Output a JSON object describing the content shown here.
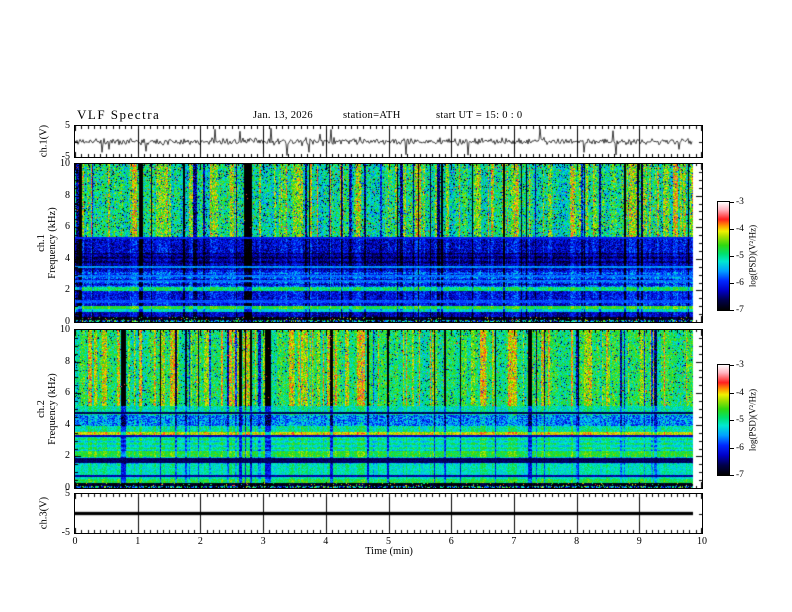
{
  "title": "VLF  Spectra",
  "header": {
    "date": "Jan. 13, 2026",
    "station": "station=ATH",
    "start_ut": "start UT =  15: 0  : 0"
  },
  "time_axis": {
    "label": "Time  (min)",
    "range": [
      0,
      10
    ],
    "ticks": [
      0,
      1,
      2,
      3,
      4,
      5,
      6,
      7,
      8,
      9,
      10
    ],
    "minor_step_min": 0.1,
    "data_end_min": 9.85
  },
  "colorbar": {
    "label": "log(PSD)(V²/Hz)",
    "ticks": [
      -3,
      -4,
      -5,
      -6,
      -7
    ],
    "range": [
      -7,
      -3
    ],
    "stops": [
      [
        0.0,
        "#000000"
      ],
      [
        0.09,
        "#00004a"
      ],
      [
        0.18,
        "#0000c8"
      ],
      [
        0.27,
        "#0028ff"
      ],
      [
        0.36,
        "#00a0ff"
      ],
      [
        0.45,
        "#00e8d0"
      ],
      [
        0.52,
        "#00e070"
      ],
      [
        0.6,
        "#30d810"
      ],
      [
        0.68,
        "#a8e000"
      ],
      [
        0.73,
        "#f0f000"
      ],
      [
        0.78,
        "#ff9800"
      ],
      [
        0.84,
        "#ff2020"
      ],
      [
        0.93,
        "#ffb4c0"
      ],
      [
        1.0,
        "#ffffff"
      ]
    ]
  },
  "colors": {
    "background": "#ffffff",
    "frame": "#000000",
    "trace": "#000000"
  },
  "chart_data": [
    {
      "type": "line",
      "id": "ch1_wave",
      "ylabel": "ch.1(V)",
      "ylim": [
        -5,
        5
      ],
      "yticks": [
        5,
        -5
      ],
      "description": "broadband noise about 0 V, ~±1 V band with impulsive spikes to ±5 V, data 0–9.85 min",
      "signal": {
        "mean": 0,
        "noise_sigma": 0.5,
        "spike_prob": 0.022,
        "spike_amp": [
          2.2,
          4.8
        ]
      },
      "seed": 11
    },
    {
      "type": "heatmap",
      "id": "ch1_spec",
      "ylabel_lines": [
        "ch.1",
        "Frequency  (kHz)"
      ],
      "ylim": [
        0,
        10
      ],
      "yticks": [
        10,
        8,
        6,
        4,
        2,
        0
      ],
      "value_range": [
        -7,
        -3
      ],
      "streak_min_f": 5.25,
      "seed": 42,
      "bands": [
        {
          "f": [
            5.25,
            10.0
          ],
          "v": -5.0,
          "jitter": 0.6,
          "dark_speckle": 0.08,
          "red_speckle": 0.01
        },
        {
          "f": [
            4.35,
            5.25
          ],
          "v": -6.25,
          "jitter": 0.45
        },
        {
          "f": [
            3.3,
            4.35
          ],
          "v": -6.5,
          "jitter": 0.35,
          "stripe": 0.2
        },
        {
          "f": [
            2.2,
            3.3
          ],
          "v": -6.0,
          "jitter": 0.45,
          "stripe": 0.25
        },
        {
          "f": [
            1.95,
            2.2
          ],
          "v": -4.95,
          "jitter": 0.3
        },
        {
          "f": [
            1.0,
            1.95
          ],
          "v": -6.15,
          "jitter": 0.4
        },
        {
          "f": [
            0.82,
            1.0
          ],
          "v": -4.7,
          "jitter": 0.25
        },
        {
          "f": [
            0.62,
            0.82
          ],
          "v": -5.3,
          "jitter": 0.3
        },
        {
          "f": [
            0.3,
            0.62
          ],
          "v": -6.35,
          "jitter": 0.35
        },
        {
          "f": [
            0.12,
            0.3
          ],
          "v": -6.95,
          "jitter": 0.1,
          "speckle": 0.06
        },
        {
          "f": [
            0.0,
            0.12
          ],
          "v": -5.8,
          "jitter": 1.5
        }
      ],
      "h_lines": [
        {
          "f": 5.3,
          "v": -6.0
        },
        {
          "f": 3.5,
          "v": -5.6
        },
        {
          "f": 2.9,
          "v": -5.7
        },
        {
          "f": 2.6,
          "v": -5.7
        },
        {
          "f": 1.3,
          "v": -5.8
        }
      ]
    },
    {
      "type": "heatmap",
      "id": "ch2_spec",
      "ylabel_lines": [
        "ch.2",
        "Frequency  (kHz)"
      ],
      "ylim": [
        0,
        10
      ],
      "yticks": [
        10,
        8,
        6,
        4,
        2,
        0
      ],
      "value_range": [
        -7,
        -3
      ],
      "streak_min_f": 5.2,
      "seed": 77,
      "bands": [
        {
          "f": [
            5.2,
            10.0
          ],
          "v": -4.9,
          "jitter": 0.5,
          "dark_speckle": 0.05,
          "red_speckle": 0.008
        },
        {
          "f": [
            4.65,
            5.2
          ],
          "v": -5.15,
          "jitter": 0.4
        },
        {
          "f": [
            3.9,
            4.65
          ],
          "v": -5.7,
          "jitter": 0.55
        },
        {
          "f": [
            3.55,
            3.9
          ],
          "v": -5.1,
          "jitter": 0.35
        },
        {
          "f": [
            3.35,
            3.55
          ],
          "v": -4.2,
          "jitter": 0.35
        },
        {
          "f": [
            2.35,
            3.35
          ],
          "v": -5.15,
          "jitter": 0.3,
          "stripe": 0.25
        },
        {
          "f": [
            1.95,
            2.35
          ],
          "v": -4.75,
          "jitter": 0.3
        },
        {
          "f": [
            1.55,
            1.95
          ],
          "v": -5.4,
          "jitter": 0.4
        },
        {
          "f": [
            0.55,
            1.55
          ],
          "v": -5.2,
          "jitter": 0.3
        },
        {
          "f": [
            0.32,
            0.55
          ],
          "v": -4.85,
          "jitter": 0.3
        },
        {
          "f": [
            0.12,
            0.32
          ],
          "v": -6.95,
          "jitter": 0.1,
          "speckle": 0.06
        },
        {
          "f": [
            0.0,
            0.12
          ],
          "v": -5.8,
          "jitter": 1.5
        }
      ],
      "h_lines": [
        {
          "f": 4.75,
          "v": -6.6
        },
        {
          "f": 3.3,
          "v": -6.3
        },
        {
          "f": 1.8,
          "v": -6.6
        },
        {
          "f": 1.68,
          "v": -6.6
        },
        {
          "f": 0.75,
          "v": -6.4
        }
      ]
    },
    {
      "type": "line",
      "id": "ch3_wave",
      "ylabel": "ch.3(V)",
      "ylim": [
        -5,
        5
      ],
      "yticks": [
        5,
        -5
      ],
      "description": "flat signal at 0 V drawn as a thick black bar, data 0–9.85 min",
      "signal": {
        "flat_value": 0,
        "bar_half_v": 0.7
      },
      "seed": 5
    }
  ]
}
